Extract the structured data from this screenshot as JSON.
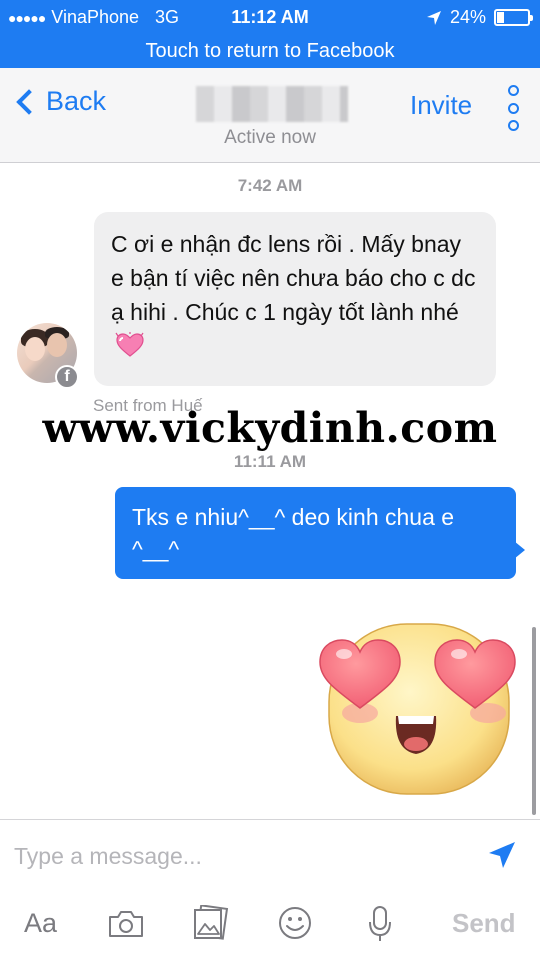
{
  "status_bar": {
    "carrier": "VinaPhone",
    "network": "3G",
    "time": "11:12 AM",
    "battery": "24%",
    "battery_level": 0.24
  },
  "return_banner": "Touch to return to Facebook",
  "header": {
    "back_label": "Back",
    "status": "Active now",
    "invite_label": "Invite"
  },
  "conversation": {
    "timestamp_1": "7:42 AM",
    "incoming_message": "C ơi e nhận đc lens rồi . Mấy bnay e bận tí việc nên chưa báo cho c dc ạ hihi . Chúc c 1 ngày tốt lành nhé",
    "sent_from": "Sent from Huế",
    "watermark": "www.vickydinh.com",
    "timestamp_2": "11:11 AM",
    "outgoing_message": "Tks e nhiu^__^ deo kinh chua e ^__^"
  },
  "composer": {
    "placeholder": "Type a message...",
    "aa_label": "Aa",
    "send_label": "Send"
  },
  "icons": [
    "signal-dots-icon",
    "location-arrow-icon",
    "battery-icon",
    "chevron-left-icon",
    "more-vertical-icon",
    "facebook-badge-icon",
    "heart-eyes-sticker",
    "send-arrow-icon",
    "camera-icon",
    "gallery-icon",
    "smiley-icon",
    "microphone-icon"
  ],
  "colors": {
    "accent": "#1e7cf2",
    "incoming_bubble": "#efeff0",
    "muted_text": "#9a9a9e"
  }
}
